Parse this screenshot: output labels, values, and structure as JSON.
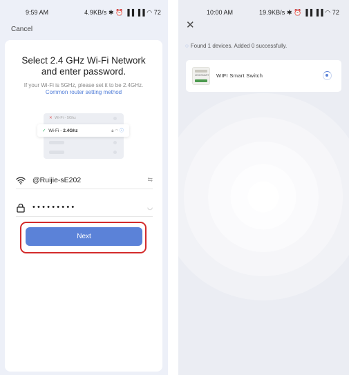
{
  "left": {
    "status_time": "9:59 AM",
    "status_net": "4.9KB/s ✱ ⏰ ▐▐ ▐▐ ◠ 72",
    "cancel_label": "Cancel",
    "title_line1": "Select 2.4 GHz Wi-Fi Network",
    "title_line2": "and enter password.",
    "hint_text": "If your Wi-Fi is 5GHz, please set it to be 2.4GHz.",
    "hint_link": "Common router setting method",
    "illus": {
      "row_5g_label": "Wi-Fi - 5Ghz",
      "row_24_prefix": "Wi-Fi - ",
      "row_24_bold": "2.4Ghz"
    },
    "wifi_name": "@Ruijie-sE202",
    "password_masked": "•••••••••",
    "next_label": "Next"
  },
  "right": {
    "status_time": "10:00 AM",
    "status_net": "19.9KB/s ✱ ⏰ ▐▐ ▐▐ ◠ 72",
    "found_text": "Found 1 devices. Added 0 successfully.",
    "device_name": "WIFI Smart Switch",
    "device_thumb_text": "ZEMISMART"
  },
  "colors": {
    "accent": "#5b82d8",
    "highlight_outline": "#d32b2b",
    "link": "#4a78d6"
  }
}
